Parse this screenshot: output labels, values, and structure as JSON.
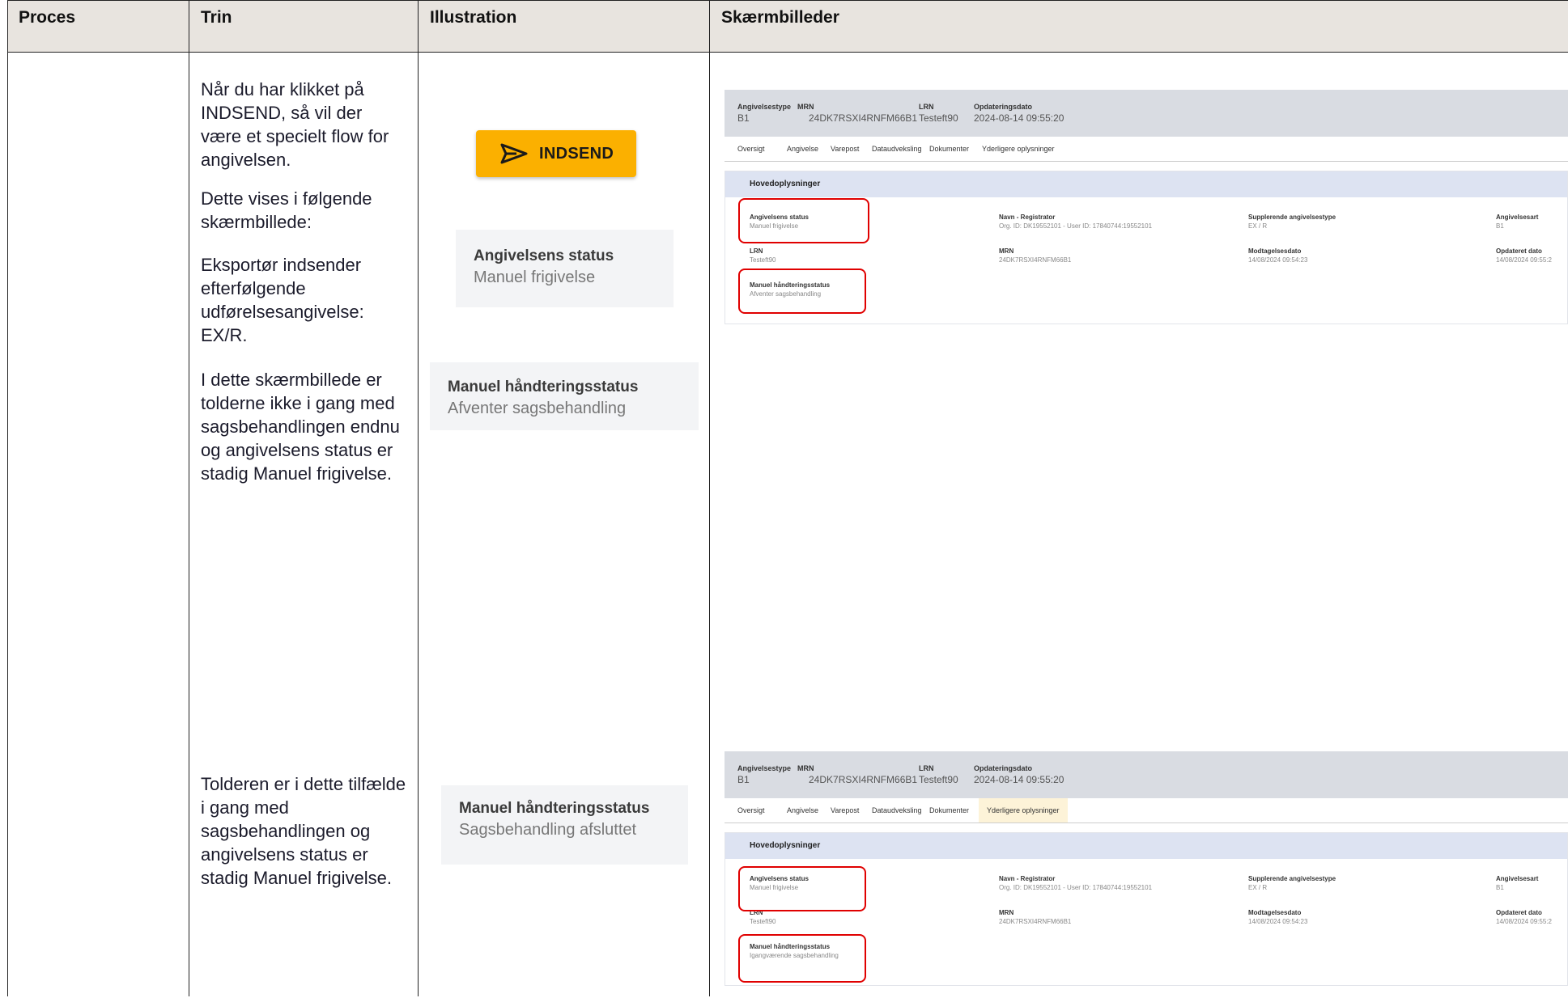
{
  "table": {
    "headers": [
      "Proces",
      "Trin",
      "Illustration",
      "Skærmbilleder"
    ]
  },
  "steps": {
    "s1": "Når du har klikket på INDSEND, så vil der være et specielt flow for angivelsen.",
    "s2": "Dette vises i følgende skærmbillede:",
    "s3": "Eksportør indsender efterfølgende udførelsesangivelse: EX/R.",
    "s4": "I dette skærmbillede er tolderne ikke i gang med sagsbehandlingen endnu og angivelsens status er stadig Manuel frigivelse.",
    "s5": "Tolderen er i dette tilfælde i gang med sagsbehandlingen og angivelsens status er stadig Manuel frigivelse."
  },
  "illustrations": {
    "indsend_label": "INDSEND",
    "card1": {
      "label": "Angivelsens status",
      "value": "Manuel frigivelse"
    },
    "card2": {
      "label": "Manuel håndteringsstatus",
      "value": "Afventer sagsbehandling"
    },
    "card3": {
      "label": "Manuel håndteringsstatus",
      "value": "Sagsbehandling afsluttet"
    }
  },
  "screenshots": [
    {
      "header": [
        {
          "k": "Angivelsestype",
          "v": "B1"
        },
        {
          "k": "MRN",
          "v": "24DK7RSXI4RNFM66B1"
        },
        {
          "k": "LRN",
          "v": "Testeft90"
        },
        {
          "k": "Opdateringsdato",
          "v": "2024-08-14 09:55:20"
        }
      ],
      "tabs": [
        "Oversigt",
        "Angivelse",
        "Varepost",
        "Dataudveksling",
        "Dokumenter",
        "Yderligere oplysninger"
      ],
      "panel_title": "Hovedoplysninger",
      "fields": [
        {
          "k": "Angivelsens status",
          "v": "Manuel frigivelse"
        },
        {
          "k": "Navn - Registrator",
          "v": "Org. ID: DK19552101 - User ID: 17840744:19552101"
        },
        {
          "k": "Supplerende angivelsestype",
          "v": "EX / R"
        },
        {
          "k": "Angivelsesart",
          "v": "B1"
        },
        {
          "k": "LRN",
          "v": "Testeft90"
        },
        {
          "k": "MRN",
          "v": "24DK7RSXI4RNFM66B1"
        },
        {
          "k": "Modtagelsesdato",
          "v": "14/08/2024 09:54:23"
        },
        {
          "k": "Opdateret dato",
          "v": "14/08/2024 09:55:2"
        },
        {
          "k": "Manuel håndteringsstatus",
          "v": "Afventer sagsbehandling"
        }
      ]
    },
    {
      "header": [
        {
          "k": "Angivelsestype",
          "v": "B1"
        },
        {
          "k": "MRN",
          "v": "24DK7RSXI4RNFM66B1"
        },
        {
          "k": "LRN",
          "v": "Testeft90"
        },
        {
          "k": "Opdateringsdato",
          "v": "2024-08-14 09:55:20"
        }
      ],
      "tabs": [
        "Oversigt",
        "Angivelse",
        "Varepost",
        "Dataudveksling",
        "Dokumenter",
        "Yderligere oplysninger"
      ],
      "panel_title": "Hovedoplysninger",
      "fields": [
        {
          "k": "Angivelsens status",
          "v": "Manuel frigivelse"
        },
        {
          "k": "Navn - Registrator",
          "v": "Org. ID: DK19552101 - User ID: 17840744:19552101"
        },
        {
          "k": "Supplerende angivelsestype",
          "v": "EX / R"
        },
        {
          "k": "Angivelsesart",
          "v": "B1"
        },
        {
          "k": "LRN",
          "v": "Testeft90"
        },
        {
          "k": "MRN",
          "v": "24DK7RSXI4RNFM66B1"
        },
        {
          "k": "Modtagelsesdato",
          "v": "14/08/2024 09:54:23"
        },
        {
          "k": "Opdateret dato",
          "v": "14/08/2024 09:55:2"
        },
        {
          "k": "Manuel håndteringsstatus",
          "v": "Igangværende sagsbehandling"
        }
      ]
    }
  ]
}
